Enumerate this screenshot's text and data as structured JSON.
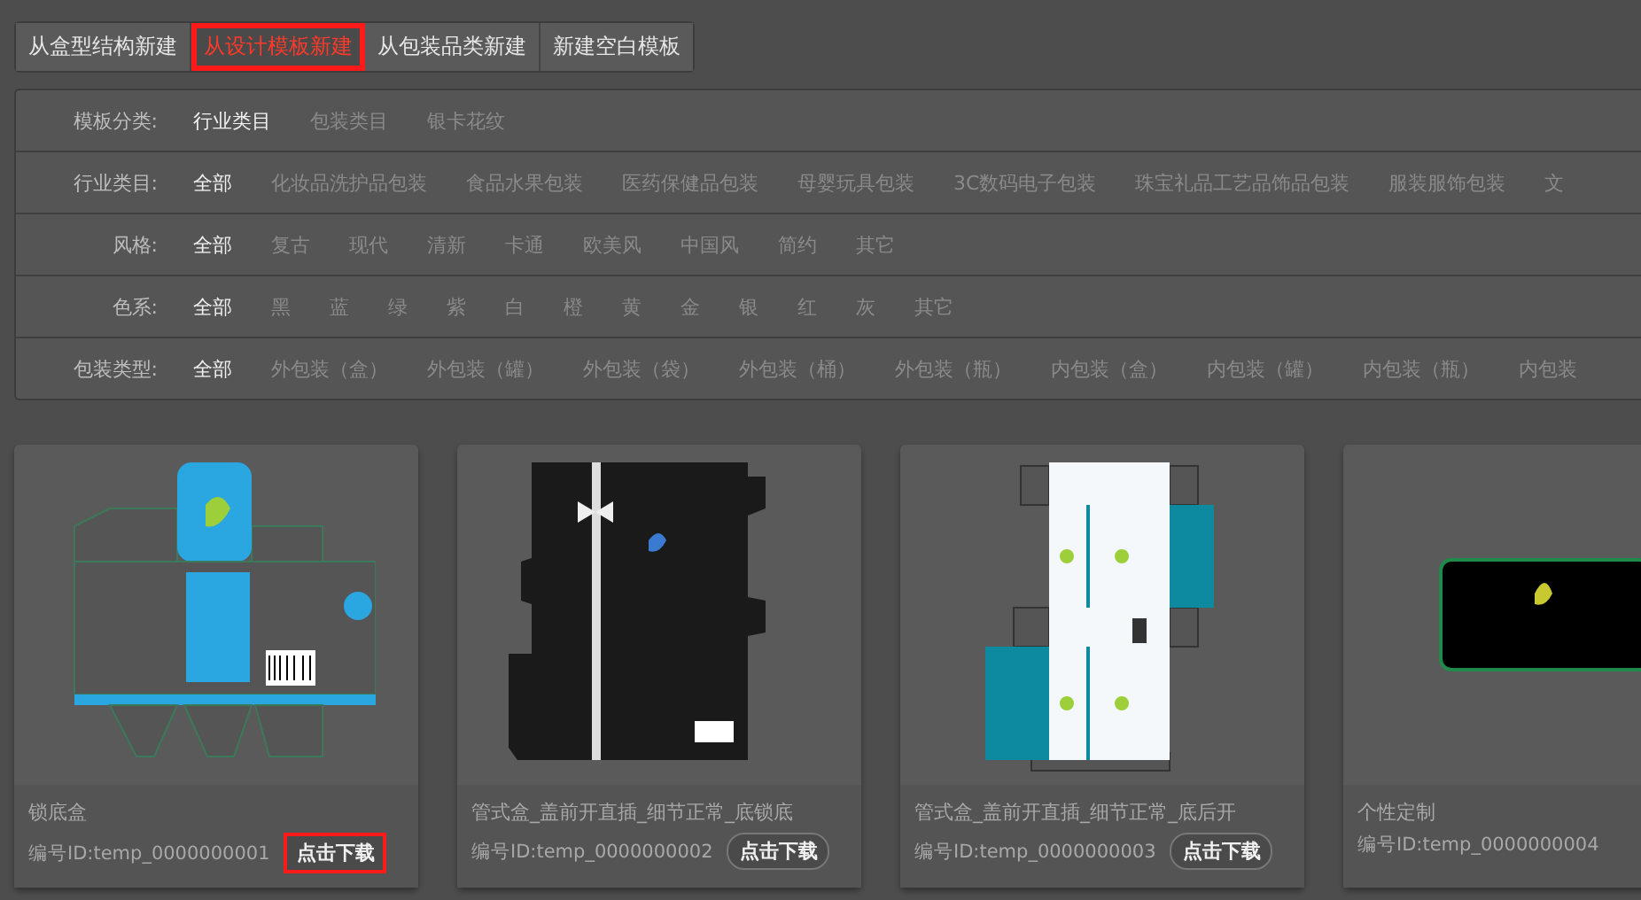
{
  "tabs": [
    {
      "label": "从盒型结构新建",
      "selected": false,
      "highlighted": false
    },
    {
      "label": "从设计模板新建",
      "selected": true,
      "highlighted": true
    },
    {
      "label": "从包装品类新建",
      "selected": false,
      "highlighted": false
    },
    {
      "label": "新建空白模板",
      "selected": false,
      "highlighted": false
    }
  ],
  "filters": [
    {
      "label": "模板分类:",
      "options": [
        {
          "text": "行业类目",
          "selected": true
        },
        {
          "text": "包装类目",
          "selected": false
        },
        {
          "text": "银卡花纹",
          "selected": false
        }
      ]
    },
    {
      "label": "行业类目:",
      "options": [
        {
          "text": "全部",
          "selected": true
        },
        {
          "text": "化妆品洗护品包装",
          "selected": false
        },
        {
          "text": "食品水果包装",
          "selected": false
        },
        {
          "text": "医药保健品包装",
          "selected": false
        },
        {
          "text": "母婴玩具包装",
          "selected": false
        },
        {
          "text": "3C数码电子包装",
          "selected": false
        },
        {
          "text": "珠宝礼品工艺品饰品包装",
          "selected": false
        },
        {
          "text": "服装服饰包装",
          "selected": false
        },
        {
          "text": "文",
          "selected": false
        }
      ]
    },
    {
      "label": "风格:",
      "options": [
        {
          "text": "全部",
          "selected": true
        },
        {
          "text": "复古",
          "selected": false
        },
        {
          "text": "现代",
          "selected": false
        },
        {
          "text": "清新",
          "selected": false
        },
        {
          "text": "卡通",
          "selected": false
        },
        {
          "text": "欧美风",
          "selected": false
        },
        {
          "text": "中国风",
          "selected": false
        },
        {
          "text": "简约",
          "selected": false
        },
        {
          "text": "其它",
          "selected": false
        }
      ]
    },
    {
      "label": "色系:",
      "options": [
        {
          "text": "全部",
          "selected": true
        },
        {
          "text": "黑",
          "selected": false
        },
        {
          "text": "蓝",
          "selected": false
        },
        {
          "text": "绿",
          "selected": false
        },
        {
          "text": "紫",
          "selected": false
        },
        {
          "text": "白",
          "selected": false
        },
        {
          "text": "橙",
          "selected": false
        },
        {
          "text": "黄",
          "selected": false
        },
        {
          "text": "金",
          "selected": false
        },
        {
          "text": "银",
          "selected": false
        },
        {
          "text": "红",
          "selected": false
        },
        {
          "text": "灰",
          "selected": false
        },
        {
          "text": "其它",
          "selected": false
        }
      ]
    },
    {
      "label": "包装类型:",
      "options": [
        {
          "text": "全部",
          "selected": true
        },
        {
          "text": "外包装（盒）",
          "selected": false
        },
        {
          "text": "外包装（罐）",
          "selected": false
        },
        {
          "text": "外包装（袋）",
          "selected": false
        },
        {
          "text": "外包装（桶）",
          "selected": false
        },
        {
          "text": "外包装（瓶）",
          "selected": false
        },
        {
          "text": "内包装（盒）",
          "selected": false
        },
        {
          "text": "内包装（罐）",
          "selected": false
        },
        {
          "text": "内包装（瓶）",
          "selected": false
        },
        {
          "text": "内包装",
          "selected": false
        }
      ]
    }
  ],
  "cards": [
    {
      "kind": "blue-dieline",
      "title": "锁底盒",
      "id": "编号ID:temp_0000000001",
      "button": "点击下载",
      "highlighted": true
    },
    {
      "kind": "black-dieline",
      "title": "管式盒_盖前开直插_细节正常_底锁底",
      "id": "编号ID:temp_0000000002",
      "button": "点击下载",
      "highlighted": false
    },
    {
      "kind": "teal-dieline",
      "title": "管式盒_盖前开直插_细节正常_底后开",
      "id": "编号ID:temp_0000000003",
      "button": "点击下载",
      "highlighted": false
    },
    {
      "kind": "black-card",
      "title": "个性定制",
      "id": "编号ID:temp_0000000004"
    }
  ]
}
